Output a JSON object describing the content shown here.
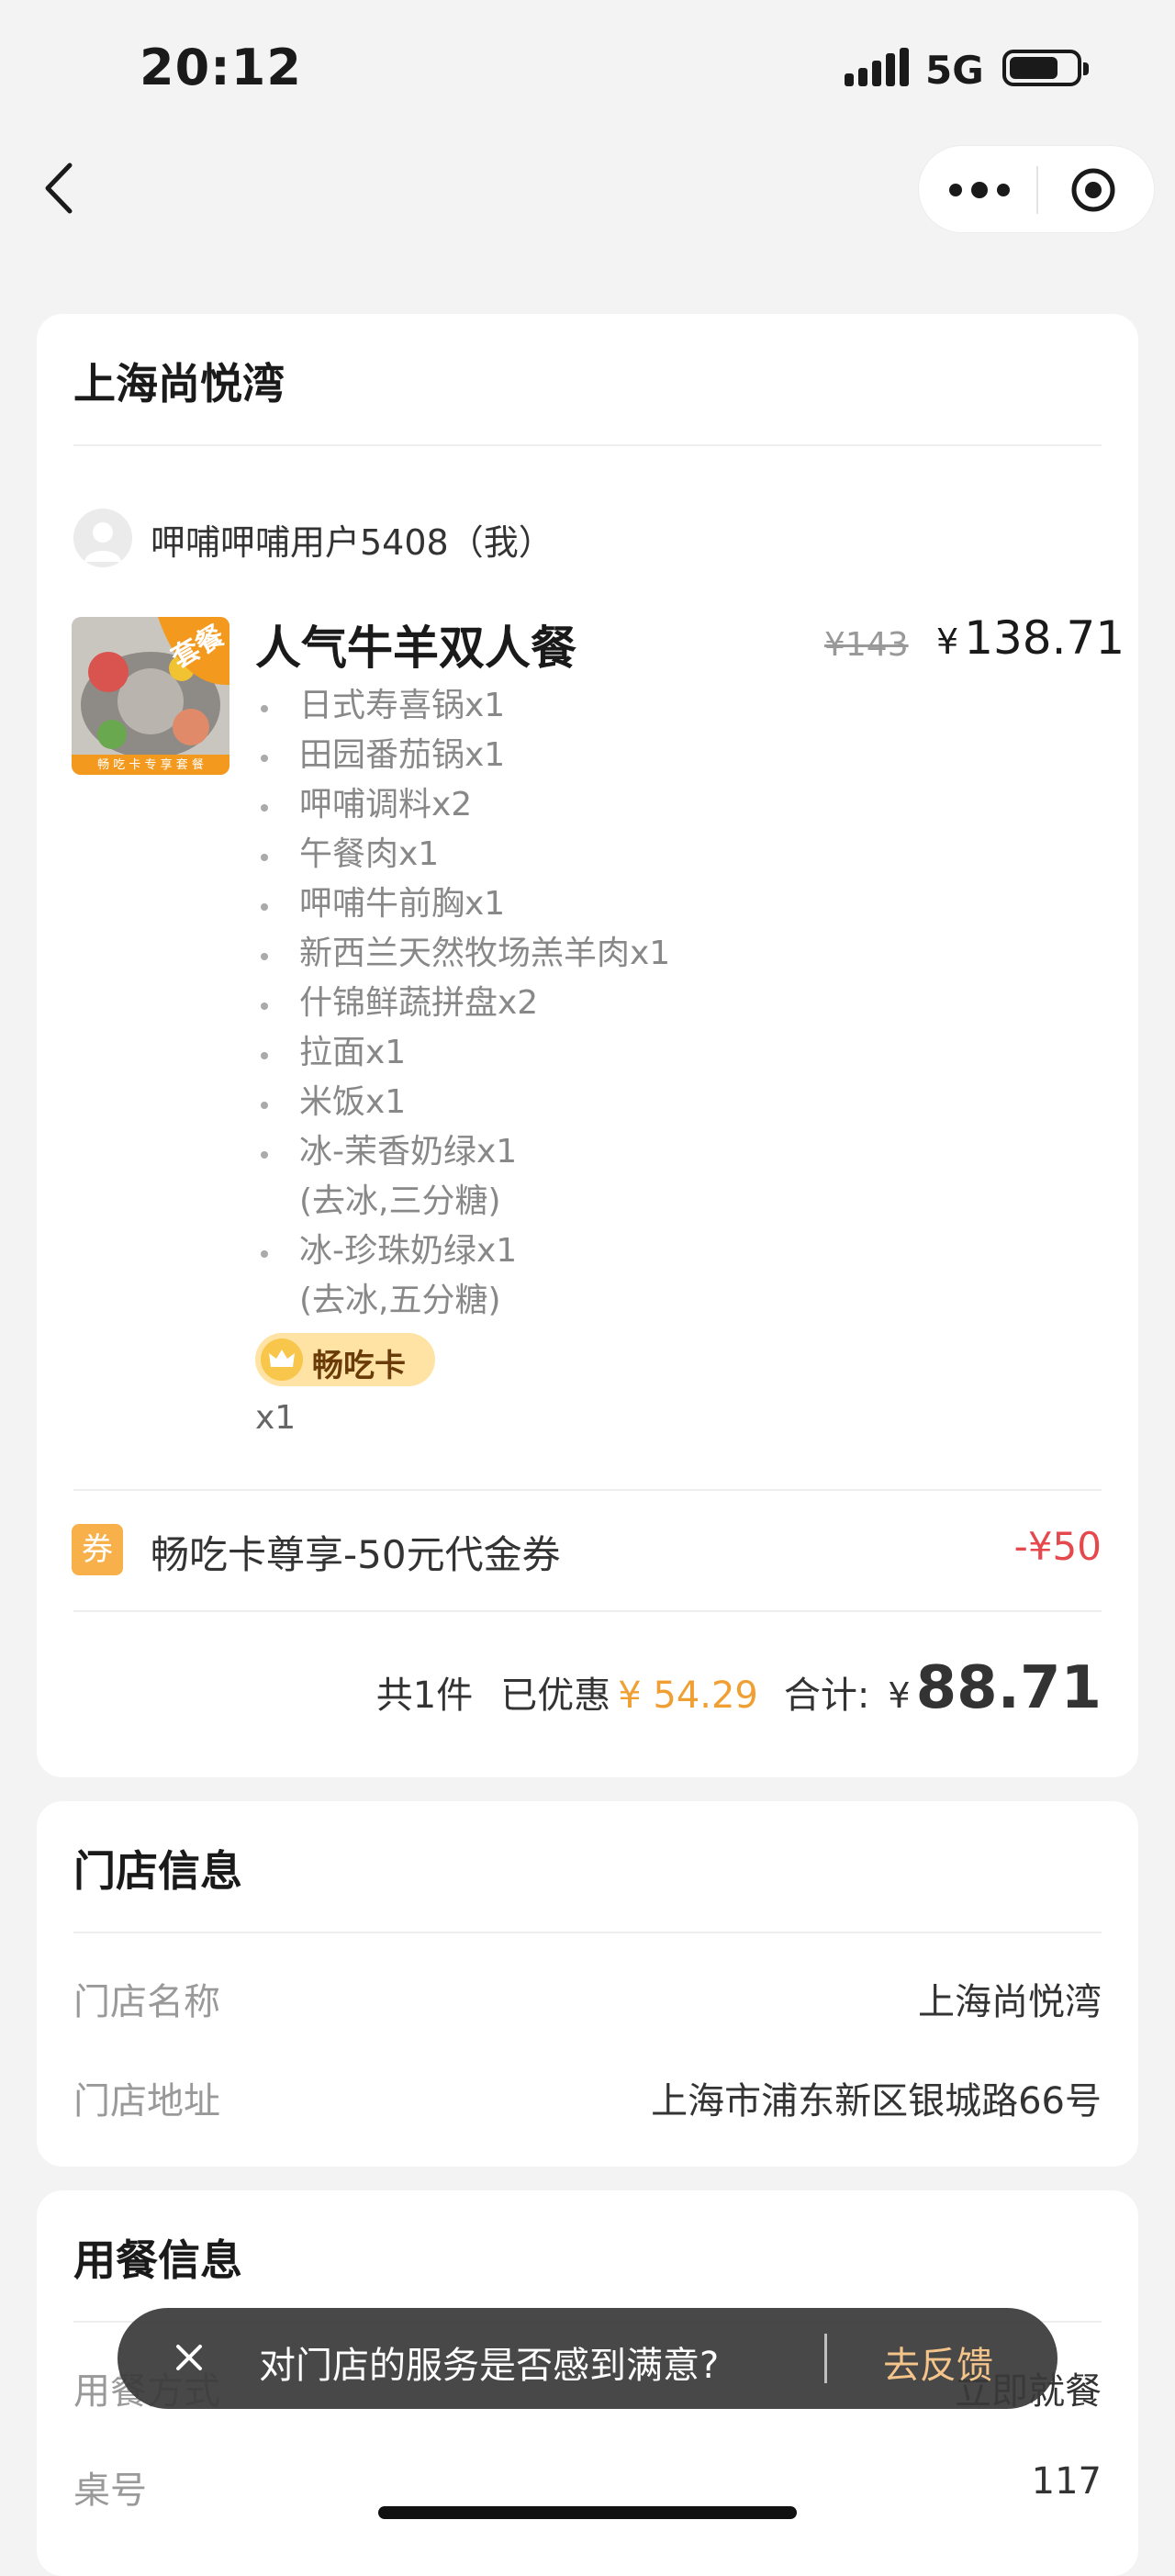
{
  "status_bar": {
    "time": "20:12",
    "network": "5G"
  },
  "order": {
    "store_title": "上海尚悦湾",
    "user": "呷哺呷哺用户5408（我）",
    "meal": {
      "name": "人气牛羊双人餐",
      "image_tag": "套餐",
      "image_caption": "畅 吃 卡 专 享 套 餐",
      "original_price": "¥143",
      "price_symbol": "¥",
      "price": "138.71",
      "items": [
        {
          "name": "日式寿喜锅x1"
        },
        {
          "name": "田园番茄锅x1"
        },
        {
          "name": "呷哺调料x2"
        },
        {
          "name": "午餐肉x1"
        },
        {
          "name": "呷哺牛前胸x1"
        },
        {
          "name": "新西兰天然牧场羔羊肉x1"
        },
        {
          "name": "什锦鲜蔬拼盘x2"
        },
        {
          "name": "拉面x1"
        },
        {
          "name": "米饭x1"
        },
        {
          "name": "冰-茉香奶绿x1",
          "note": "(去冰,三分糖)"
        },
        {
          "name": "冰-珍珠奶绿x1",
          "note": "(去冰,五分糖)"
        }
      ],
      "badge": "畅吃卡",
      "quantity": "x1"
    },
    "coupon": {
      "icon": "券",
      "label": "畅吃卡尊享-50元代金券",
      "value": "-¥50"
    },
    "summary": {
      "count": "共1件",
      "saved_label": "已优惠",
      "saved_value": "¥ 54.29",
      "total_label": "合计:",
      "total_symbol": "¥",
      "total": "88.71"
    }
  },
  "store_info": {
    "title": "门店信息",
    "rows": [
      {
        "label": "门店名称",
        "value": "上海尚悦湾"
      },
      {
        "label": "门店地址",
        "value": "上海市浦东新区银城路66号"
      }
    ]
  },
  "dining_info": {
    "title": "用餐信息",
    "rows": [
      {
        "label": "用餐方式",
        "value": "立即就餐"
      },
      {
        "label": "桌号",
        "value": "117"
      }
    ]
  },
  "toast": {
    "message": "对门店的服务是否感到满意?",
    "action": "去反馈"
  },
  "colors": {
    "accent_orange": "#f0a033",
    "discount_red": "#e5484d",
    "badge_bg": "#ffe3a4"
  }
}
